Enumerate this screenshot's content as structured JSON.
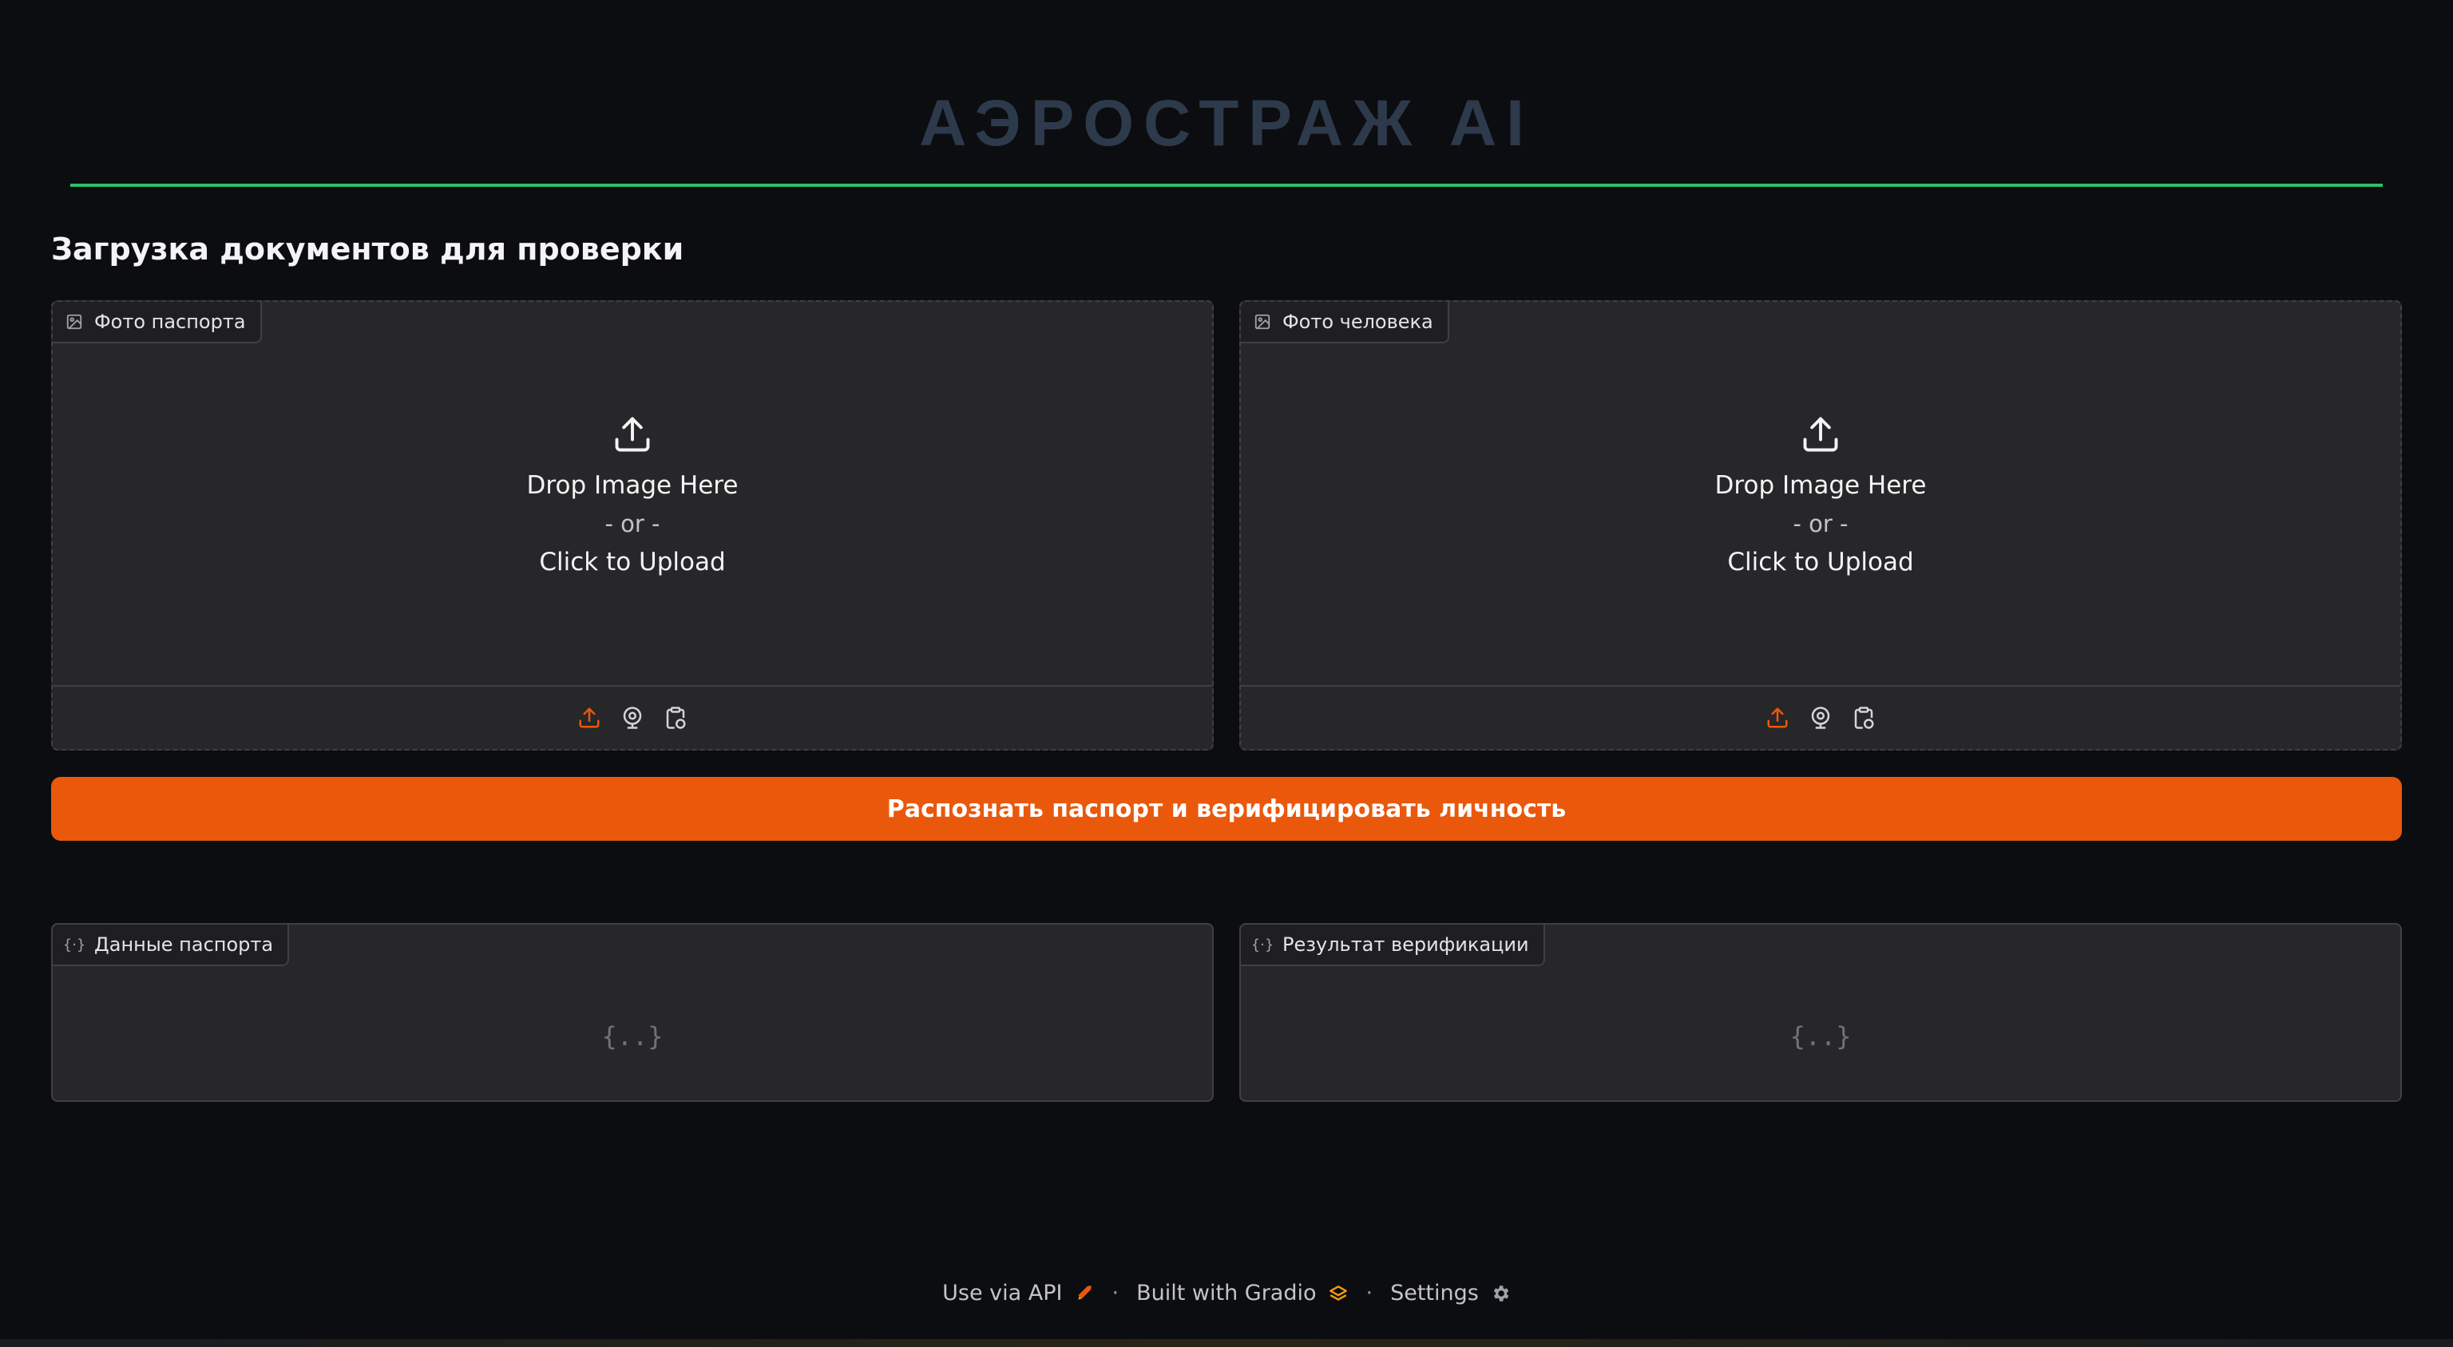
{
  "app": {
    "title": "АЭРОСТРАЖ AI"
  },
  "upload_section": {
    "heading": "Загрузка документов для проверки"
  },
  "passport_upload": {
    "label": "Фото паспорта",
    "drop_text": "Drop Image Here",
    "or_text": "- or -",
    "click_text": "Click to Upload"
  },
  "person_upload": {
    "label": "Фото человека",
    "drop_text": "Drop Image Here",
    "or_text": "- or -",
    "click_text": "Click to Upload"
  },
  "actions": {
    "submit_label": "Распознать паспорт и верифицировать личность"
  },
  "passport_data": {
    "label": "Данные паспорта",
    "empty_glyph": "{..}"
  },
  "verification_result": {
    "label": "Результат верификации",
    "empty_glyph": "{..}"
  },
  "footer": {
    "api_label": "Use via API",
    "gradio_label": "Built with Gradio",
    "settings_label": "Settings",
    "separator": "·"
  },
  "colors": {
    "accent": "#ea580c",
    "title": "#2d3a4b",
    "rule": "#2fbf6a",
    "panel_bg": "#27272a",
    "page_bg": "#0c0d10"
  },
  "icons": {
    "label_image": "image-icon",
    "label_json": "json-braces-icon",
    "upload": "upload-icon",
    "webcam": "webcam-icon",
    "clipboard": "clipboard-icon"
  }
}
